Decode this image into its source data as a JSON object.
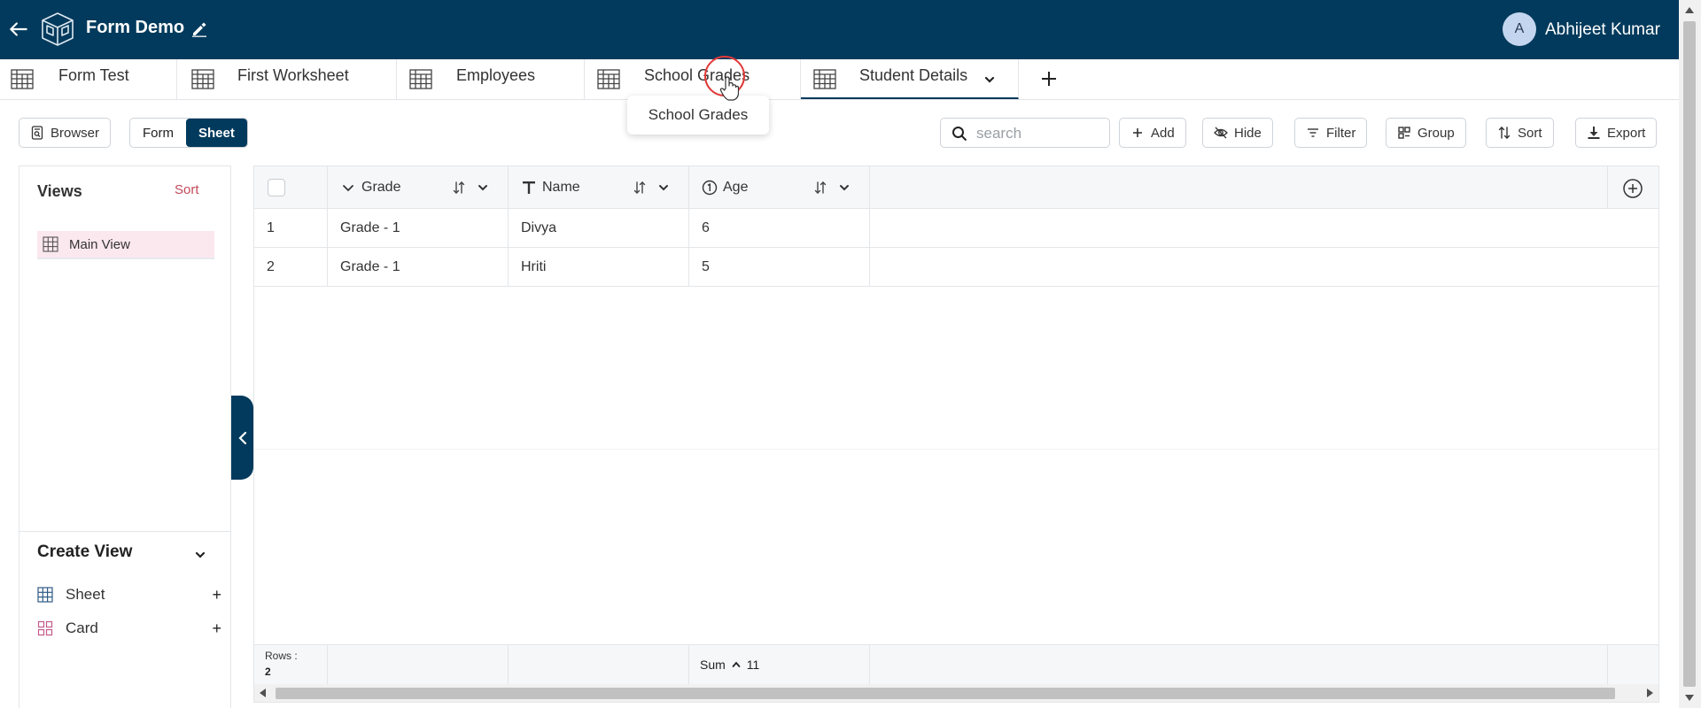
{
  "header": {
    "title": "Form Demo",
    "user_initial": "A",
    "user_name": "Abhijeet Kumar",
    "bg_color": "#013a5c"
  },
  "tabs": [
    {
      "label": "Form Test"
    },
    {
      "label": "First Worksheet"
    },
    {
      "label": "Employees"
    },
    {
      "label": "School Grades"
    },
    {
      "label": "Student Details",
      "active": true
    }
  ],
  "tooltip": "School Grades",
  "toolbar": {
    "browser": "Browser",
    "form": "Form",
    "sheet": "Sheet",
    "search_placeholder": "search",
    "add": "Add",
    "hide": "Hide",
    "filter": "Filter",
    "group": "Group",
    "sort": "Sort",
    "export": "Export"
  },
  "views": {
    "title": "Views",
    "sort": "Sort",
    "items": [
      "Main View"
    ]
  },
  "create_view": {
    "title": "Create View",
    "items": [
      {
        "label": "Sheet",
        "plus": "+"
      },
      {
        "label": "Card",
        "plus": "+"
      }
    ]
  },
  "grid": {
    "columns": [
      {
        "label": "Grade",
        "icon": "chevron-down-icon"
      },
      {
        "label": "Name",
        "icon": "text-type-icon"
      },
      {
        "label": "Age",
        "icon": "number-type-icon"
      }
    ],
    "rows": [
      {
        "num": "1",
        "cells": [
          "Grade - 1",
          "Divya",
          "6"
        ]
      },
      {
        "num": "2",
        "cells": [
          "Grade - 1",
          "Hriti",
          "5"
        ]
      }
    ],
    "footer": {
      "rows_label": "Rows :",
      "rows_count": "2",
      "sum_label": "Sum",
      "sum_value": "11"
    }
  },
  "colors": {
    "accent": "#013a5c",
    "view_active_bg": "#fbe8ee",
    "sort_link": "#c24a5a"
  }
}
